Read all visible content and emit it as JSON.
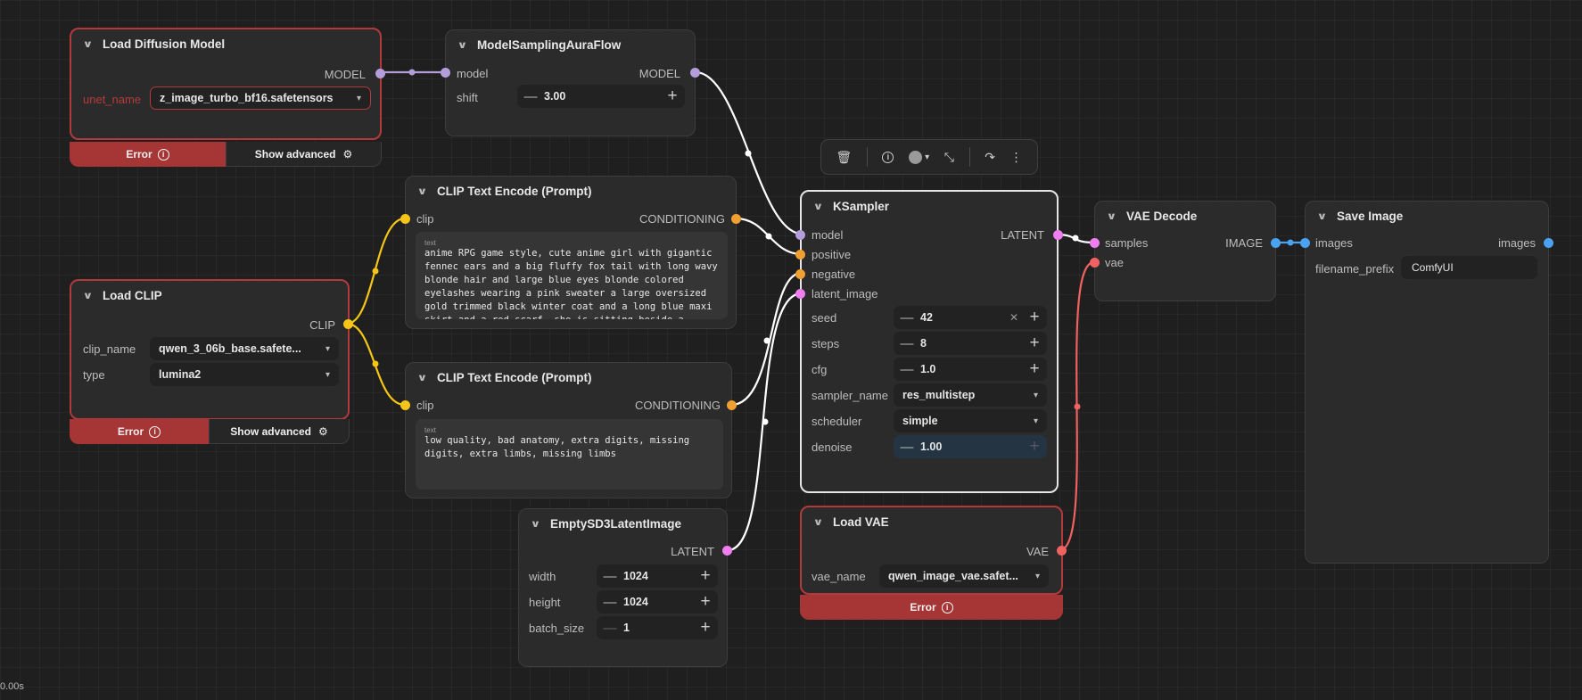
{
  "colors": {
    "model": "#b39ddb",
    "clip": "#f5c518",
    "conditioning": "#f0a030",
    "latent": "#f07ef0",
    "vae": "#f06262",
    "image": "#4aa3f0",
    "error": "#a63636"
  },
  "nodes": {
    "load_diffusion": {
      "title": "Load Diffusion Model",
      "output": "MODEL",
      "unet_label": "unet_name",
      "unet_value": "z_image_turbo_bf16.safetensors",
      "error": "Error",
      "advanced": "Show advanced"
    },
    "model_sampling": {
      "title": "ModelSamplingAuraFlow",
      "input": "model",
      "output": "MODEL",
      "shift_label": "shift",
      "shift_value": "3.00"
    },
    "clip_pos": {
      "title": "CLIP Text Encode (Prompt)",
      "input": "clip",
      "output": "CONDITIONING",
      "text_tag": "text",
      "text": "anime RPG game style, cute anime girl with gigantic fennec ears and a big fluffy fox tail with long wavy blonde hair and large blue eyes blonde colored eyelashes wearing a pink sweater a large oversized gold trimmed black winter coat and a long blue maxi skirt and a red scarf, she is sitting beside a"
    },
    "clip_neg": {
      "title": "CLIP Text Encode (Prompt)",
      "input": "clip",
      "output": "CONDITIONING",
      "text_tag": "text",
      "text": "low quality, bad anatomy, extra digits, missing digits, extra limbs, missing limbs"
    },
    "load_clip": {
      "title": "Load CLIP",
      "output": "CLIP",
      "clip_name_label": "clip_name",
      "clip_name_value": "qwen_3_06b_base.safete...",
      "type_label": "type",
      "type_value": "lumina2",
      "error": "Error",
      "advanced": "Show advanced"
    },
    "empty_latent": {
      "title": "EmptySD3LatentImage",
      "output": "LATENT",
      "width_label": "width",
      "width_value": "1024",
      "height_label": "height",
      "height_value": "1024",
      "batch_label": "batch_size",
      "batch_value": "1"
    },
    "ksampler": {
      "title": "KSampler",
      "inputs": [
        "model",
        "positive",
        "negative",
        "latent_image"
      ],
      "output": "LATENT",
      "seed_label": "seed",
      "seed_value": "42",
      "steps_label": "steps",
      "steps_value": "8",
      "cfg_label": "cfg",
      "cfg_value": "1.0",
      "sampler_label": "sampler_name",
      "sampler_value": "res_multistep",
      "scheduler_label": "scheduler",
      "scheduler_value": "simple",
      "denoise_label": "denoise",
      "denoise_value": "1.00"
    },
    "load_vae": {
      "title": "Load VAE",
      "output": "VAE",
      "vae_label": "vae_name",
      "vae_value": "qwen_image_vae.safet...",
      "error": "Error"
    },
    "vae_decode": {
      "title": "VAE Decode",
      "input_samples": "samples",
      "input_vae": "vae",
      "output": "IMAGE"
    },
    "save_image": {
      "title": "Save Image",
      "input": "images",
      "output": "images",
      "prefix_label": "filename_prefix",
      "prefix_value": "ComfyUI"
    }
  },
  "toolbar": {
    "icons": [
      "trash-icon",
      "info-icon",
      "color-picker-icon",
      "collapse-icon",
      "bypass-icon",
      "more-icon"
    ]
  },
  "status": {
    "timer": "0.00s"
  }
}
